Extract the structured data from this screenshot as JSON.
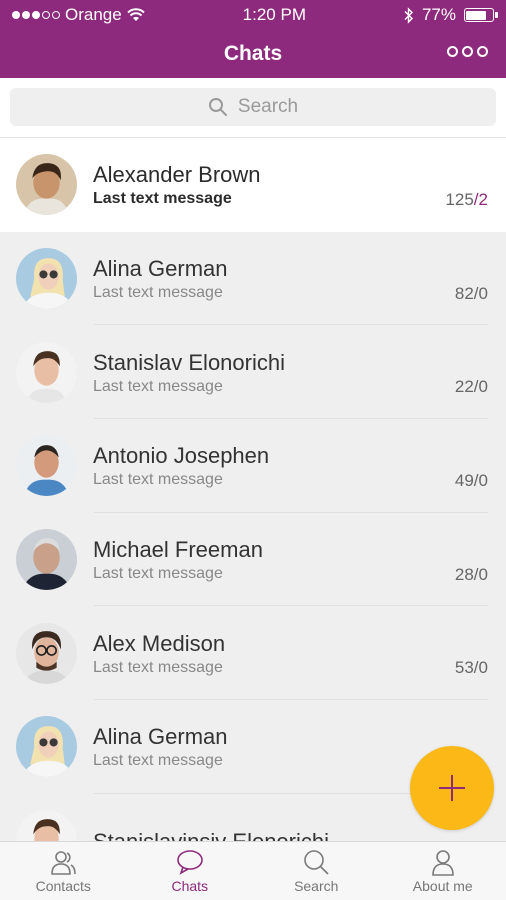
{
  "status_bar": {
    "carrier": "Orange",
    "time": "1:20 PM",
    "battery": "77%",
    "battery_level": 0.77,
    "signal_bars_filled": 3,
    "signal_bars_total": 5
  },
  "header": {
    "title": "Chats",
    "background_color": "#8e2a7e"
  },
  "search": {
    "placeholder": "Search"
  },
  "chats": [
    {
      "name": "Alexander Brown",
      "message": "Last text message",
      "count": "125",
      "count_new": "2",
      "highlighted": true,
      "avatar": "male-dark-hair-avatar"
    },
    {
      "name": "Alina German",
      "message": "Last text message",
      "count": "82",
      "count_new": "0",
      "highlighted": false,
      "avatar": "female-blonde-sunglasses-avatar"
    },
    {
      "name": "Stanislav Elonorichi",
      "message": "Last text message",
      "count": "22",
      "count_new": "0",
      "highlighted": false,
      "avatar": "male-young-avatar"
    },
    {
      "name": "Antonio Josephen",
      "message": "Last text message",
      "count": "49",
      "count_new": "0",
      "highlighted": false,
      "avatar": "male-blue-shirt-avatar"
    },
    {
      "name": "Michael Freeman",
      "message": "Last text message",
      "count": "28",
      "count_new": "0",
      "highlighted": false,
      "avatar": "male-older-avatar"
    },
    {
      "name": "Alex Medison",
      "message": "Last text message",
      "count": "53",
      "count_new": "0",
      "highlighted": false,
      "avatar": "male-glasses-avatar"
    },
    {
      "name": "Alina German",
      "message": "Last text message",
      "count": "",
      "count_new": "",
      "highlighted": false,
      "avatar": "female-blonde-sunglasses-avatar"
    },
    {
      "name": "Stanislavinsiv Elonorichi",
      "message": "",
      "count": "",
      "count_new": "",
      "highlighted": false,
      "avatar": "male-young-avatar"
    }
  ],
  "fab": {
    "icon": "plus-icon",
    "color": "#fbb816"
  },
  "tabs": [
    {
      "label": "Contacts",
      "icon": "contacts-icon",
      "active": false
    },
    {
      "label": "Chats",
      "icon": "chat-bubble-icon",
      "active": true
    },
    {
      "label": "Search",
      "icon": "search-icon",
      "active": false
    },
    {
      "label": "About me",
      "icon": "person-icon",
      "active": false
    }
  ],
  "colors": {
    "accent": "#8e2a7e",
    "fab": "#fbb816",
    "list_background": "#efefef"
  }
}
